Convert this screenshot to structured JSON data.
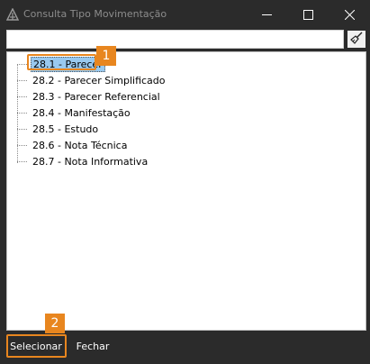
{
  "window": {
    "title": "Consulta Tipo Movimentação",
    "icons": {
      "app": "triangle-logo-icon",
      "minimize": "minimize-icon",
      "maximize": "maximize-icon",
      "close": "close-icon"
    }
  },
  "search": {
    "value": "",
    "placeholder": "",
    "clear_icon": "broom-icon"
  },
  "tree": {
    "items": [
      {
        "label": "28.1 - Parecer",
        "selected": true
      },
      {
        "label": "28.2 - Parecer Simplificado",
        "selected": false
      },
      {
        "label": "28.3 - Parecer Referencial",
        "selected": false
      },
      {
        "label": "28.4 - Manifestação",
        "selected": false
      },
      {
        "label": "28.5 - Estudo",
        "selected": false
      },
      {
        "label": "28.6 - Nota Técnica",
        "selected": false
      },
      {
        "label": "28.7 - Nota Informativa",
        "selected": false
      }
    ]
  },
  "callouts": [
    "1",
    "2"
  ],
  "footer": {
    "select_label": "Selecionar",
    "close_label": "Fechar"
  },
  "colors": {
    "accent": "#e8861f",
    "selection": "#99c9ef",
    "chrome": "#2b2b2b"
  }
}
